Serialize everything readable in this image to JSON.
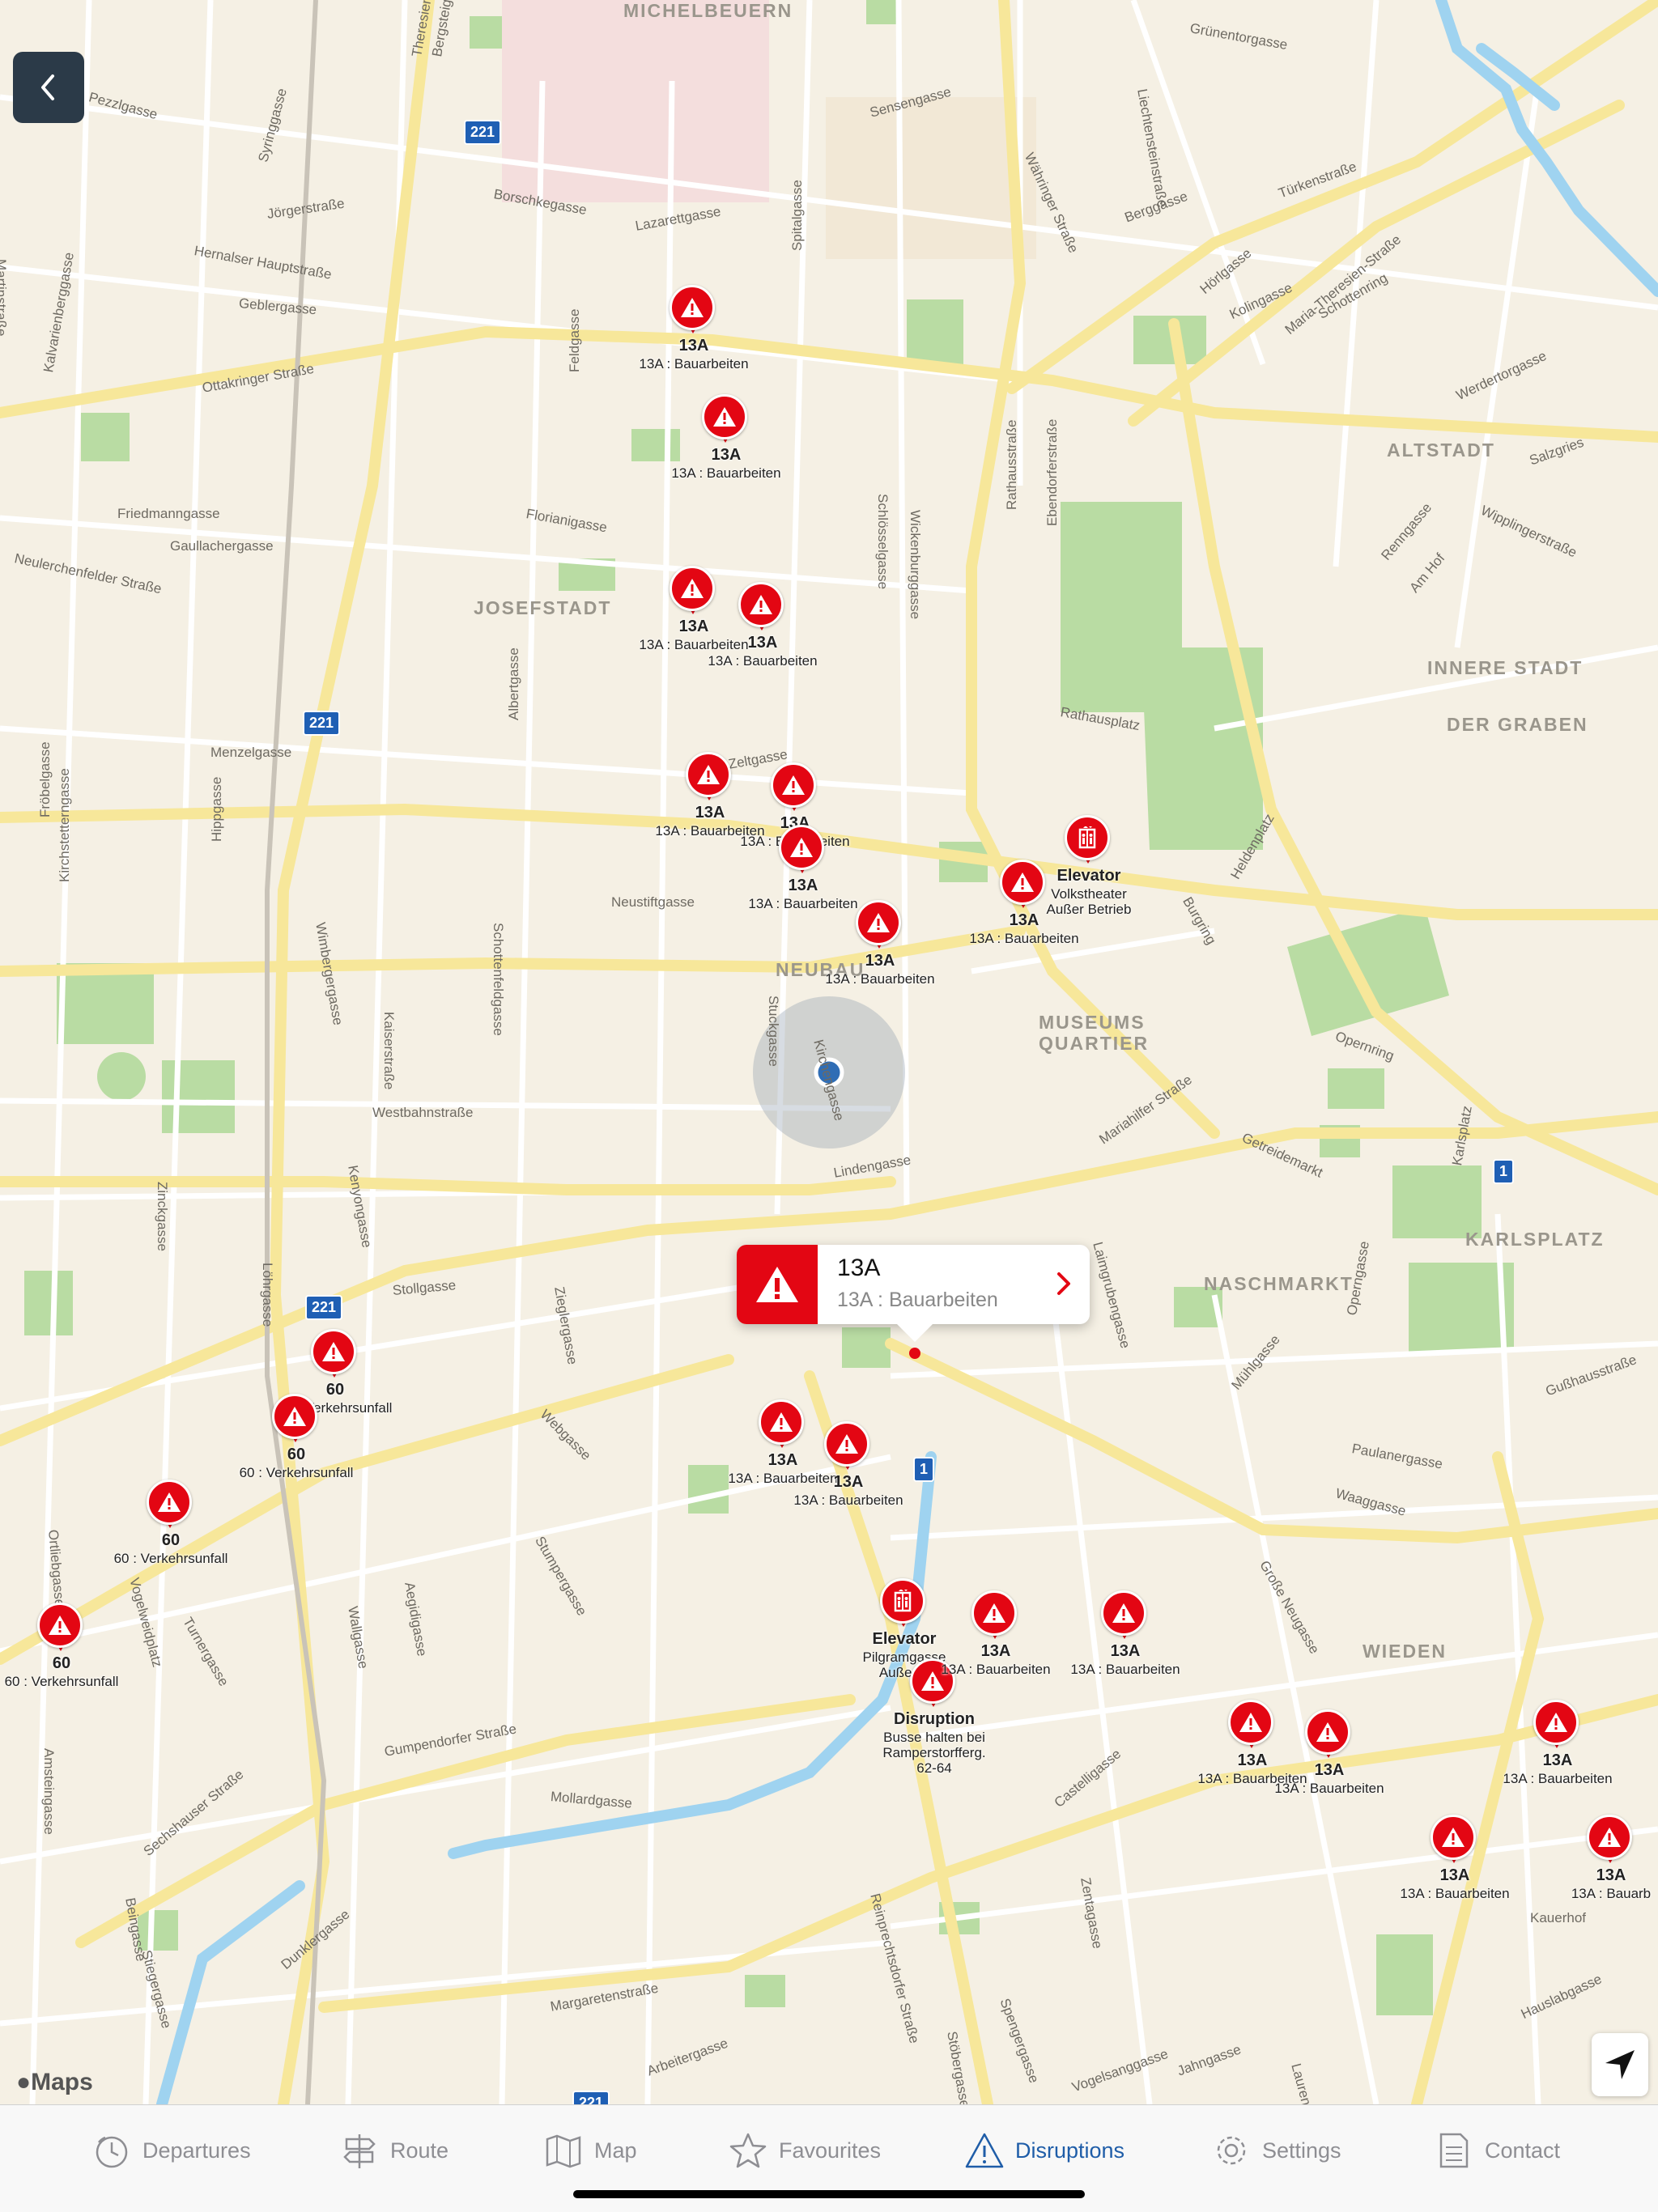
{
  "map": {
    "districts": [
      "MICHELBEUERN",
      "JOSEFSTADT",
      "NEUBAU",
      "MUSEUMS",
      "QUARTIER",
      "ALTSTADT",
      "INNERE STADT",
      "DER GRABEN",
      "KARLSPLATZ",
      "NASCHMARKT",
      "WIEDEN"
    ],
    "streets": [
      "Pezzlgasse",
      "Syringgasse",
      "Jörgerstraße",
      "Hernalser Hauptstraße",
      "Geblergasse",
      "Ottakringer Straße",
      "Kalvarienberggasse",
      "Friedmanngasse",
      "Gaullachergasse",
      "Neulerchenfelder Straße",
      "Menzelgasse",
      "Kirchstetterngasse",
      "Fröbelgasse",
      "Hippgasse",
      "Borschkegasse",
      "Lazarettgasse",
      "Spitalgasse",
      "Sensengasse",
      "Währinger Straße",
      "Berggasse",
      "Hörlgasse",
      "Türkenstraße",
      "Maria-Theresien-Straße",
      "Schottenring",
      "Wipplingerstraße",
      "Salzgries",
      "Renngasse",
      "Am Hof",
      "Werdertorgasse",
      "Grünentorgasse",
      "Liechtensteinstraße",
      "Kolingasse",
      "Florianigasse",
      "Feldgasse",
      "Schlösselgasse",
      "Wickenburggasse",
      "Rathausstraße",
      "Ebendorferstraße",
      "Rathausplatz",
      "Zeltgasse",
      "Albertgasse",
      "Neustiftgasse",
      "Schottenfeldgasse",
      "Kaiserstraße",
      "Westbahnstraße",
      "Wimbergergasse",
      "Kenyongasse",
      "Zinckgasse",
      "Löhrgasse",
      "Stollgasse",
      "Lindengasse",
      "Stuckgasse",
      "Kirchengasse",
      "Mariahilfer Straße",
      "Getreidemarkt",
      "Burgring",
      "Heldenplatz",
      "Opernring",
      "Laimgrubengasse",
      "Karlsplatz",
      "Mühlgasse",
      "Operngasse",
      "Gußhausstraße",
      "Paulanergasse",
      "Waaggasse",
      "Große Neugasse",
      "Zieglergasse",
      "Webgasse",
      "Aegidigasse",
      "Wallgasse",
      "Stumpergasse",
      "Turnergasse",
      "Gumpendorfer Straße",
      "Mollardgasse",
      "Sechshauser Straße",
      "Amsteingasse",
      "Stiegergasse",
      "Dunklergasse",
      "Margaretenstraße",
      "Arbeitergasse",
      "Reinprechtsdorfer Straße",
      "Stöbergasse",
      "Spengergasse",
      "Zentagasse",
      "Castelligasse",
      "Vogelsanggasse",
      "Jahngasse",
      "Hauslabgasse",
      "Laurenz",
      "Kauerhof",
      "Beingasse",
      "Vogelweidplatz",
      "Ortliebgasse",
      "Martinstraße",
      "Theresiengasse",
      "Bergsteiggasse"
    ],
    "route_shields": [
      "221",
      "221",
      "221",
      "221",
      "1",
      "1"
    ]
  },
  "markers": [
    {
      "kind": "warning",
      "line": "13A",
      "desc": "13A : Bauarbeiten"
    },
    {
      "kind": "warning",
      "line": "13A",
      "desc": "13A : Bauarbeiten"
    },
    {
      "kind": "warning",
      "line": "13A",
      "desc": "13A : Bauarbeiten"
    },
    {
      "kind": "warning",
      "line": "13A",
      "desc": "13A : Bauarbeiten"
    },
    {
      "kind": "warning",
      "line": "13A",
      "desc": "13A : Bauarbeiten"
    },
    {
      "kind": "warning",
      "line": "13A",
      "desc": "13A : Bauarbeiten"
    },
    {
      "kind": "warning",
      "line": "13A",
      "desc": "13A : Bauarbeiten"
    },
    {
      "kind": "warning",
      "line": "13A",
      "desc": "13A : Bauarbeiten"
    },
    {
      "kind": "warning",
      "line": "13A",
      "desc": "13A : Bauarbeiten"
    },
    {
      "kind": "elevator",
      "line": "Elevator",
      "desc": "Volkstheater\nAußer Betrieb"
    },
    {
      "kind": "warning",
      "line": "60",
      "desc": "60 : Verkehrsunfall"
    },
    {
      "kind": "warning",
      "line": "60",
      "desc": "60 : Verkehrsunfall"
    },
    {
      "kind": "warning",
      "line": "60",
      "desc": "60 : Verkehrsunfall"
    },
    {
      "kind": "warning",
      "line": "60",
      "desc": "60 : Verkehrsunfall"
    },
    {
      "kind": "warning",
      "line": "13A",
      "desc": "13A : Bauarbeiten"
    },
    {
      "kind": "warning",
      "line": "13A",
      "desc": "13A : Bauarbeiten"
    },
    {
      "kind": "elevator",
      "line": "Elevator",
      "desc": "Pilgramgasse\nAußer B"
    },
    {
      "kind": "warning",
      "line": "Disruption",
      "desc": "Busse halten bei\nRamperstorfferg.\n62-64"
    },
    {
      "kind": "warning",
      "line": "13A",
      "desc": "13A : Bauarbeiten"
    },
    {
      "kind": "warning",
      "line": "13A",
      "desc": "13A : Bauarbeiten"
    },
    {
      "kind": "warning",
      "line": "13A",
      "desc": "13A : Bauarbeiten"
    },
    {
      "kind": "warning",
      "line": "13A",
      "desc": "13A : Bauarbeiten"
    },
    {
      "kind": "warning",
      "line": "13A",
      "desc": "13A : Bauarbeiten"
    },
    {
      "kind": "warning",
      "line": "13A",
      "desc": "13A : Bauarbeiten"
    },
    {
      "kind": "warning",
      "line": "13A",
      "desc": "13A : Bauarb"
    }
  ],
  "callout": {
    "title": "13A",
    "subtitle": "13A : Bauarbeiten"
  },
  "maps_logo": "Maps",
  "tabs": [
    {
      "label": "Departures",
      "icon": "clock-icon",
      "active": false
    },
    {
      "label": "Route",
      "icon": "signpost-icon",
      "active": false
    },
    {
      "label": "Map",
      "icon": "map-icon",
      "active": false
    },
    {
      "label": "Favourites",
      "icon": "star-icon",
      "active": false
    },
    {
      "label": "Disruptions",
      "icon": "warning-icon",
      "active": true
    },
    {
      "label": "Settings",
      "icon": "gear-icon",
      "active": false
    },
    {
      "label": "Contact",
      "icon": "document-icon",
      "active": false
    }
  ],
  "colors": {
    "accent": "#1f5da8",
    "alert": "#e30613",
    "park": "#b9dca3",
    "water": "#9fd3f0",
    "road_major": "#f7e79a"
  }
}
